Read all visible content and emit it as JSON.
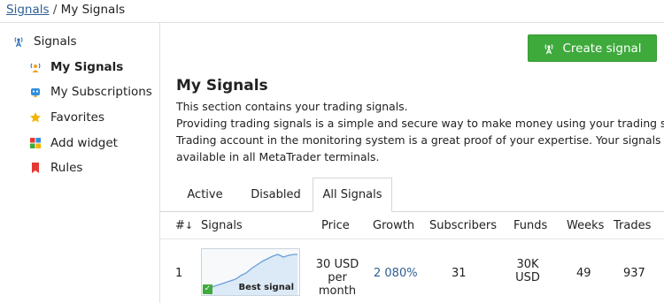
{
  "breadcrumb": {
    "parent": "Signals",
    "separator": "/",
    "current": "My Signals"
  },
  "sidebar": {
    "items": [
      {
        "label": "Signals",
        "icon": "antenna-icon"
      },
      {
        "label": "My Signals",
        "icon": "user-antenna-icon",
        "selected": true
      },
      {
        "label": "My Subscriptions",
        "icon": "robot-icon"
      },
      {
        "label": "Favorites",
        "icon": "star-icon"
      },
      {
        "label": "Add widget",
        "icon": "widget-icon"
      },
      {
        "label": "Rules",
        "icon": "bookmark-icon"
      }
    ]
  },
  "create_button": {
    "label": "Create signal"
  },
  "main": {
    "title": "My Signals",
    "description_lines": [
      "This section contains your trading signals.",
      "Providing trading signals is a simple and secure way to make money using your trading skills.",
      "Trading account in the monitoring system is a great proof of your expertise. Your signals are",
      "available in all MetaTrader terminals."
    ],
    "tabs": [
      {
        "label": "Active"
      },
      {
        "label": "Disabled"
      },
      {
        "label": "All Signals",
        "active": true
      }
    ]
  },
  "table": {
    "headers": {
      "index": "#",
      "sort_icon": "↓",
      "signals": "Signals",
      "price": "Price",
      "growth": "Growth",
      "subscribers": "Subscribers",
      "funds": "Funds",
      "weeks": "Weeks",
      "trades": "Trades"
    },
    "rows": [
      {
        "index": "1",
        "badge": "Best signal",
        "price_line1": "30 USD",
        "price_line2": "per month",
        "growth": "2 080%",
        "subscribers": "31",
        "funds_line1": "30K",
        "funds_line2": "USD",
        "weeks": "49",
        "trades": "937"
      }
    ]
  },
  "colors": {
    "accent_green": "#3eaa3c",
    "link_blue": "#2e5f94",
    "sparkline": "#6a9fd8"
  }
}
